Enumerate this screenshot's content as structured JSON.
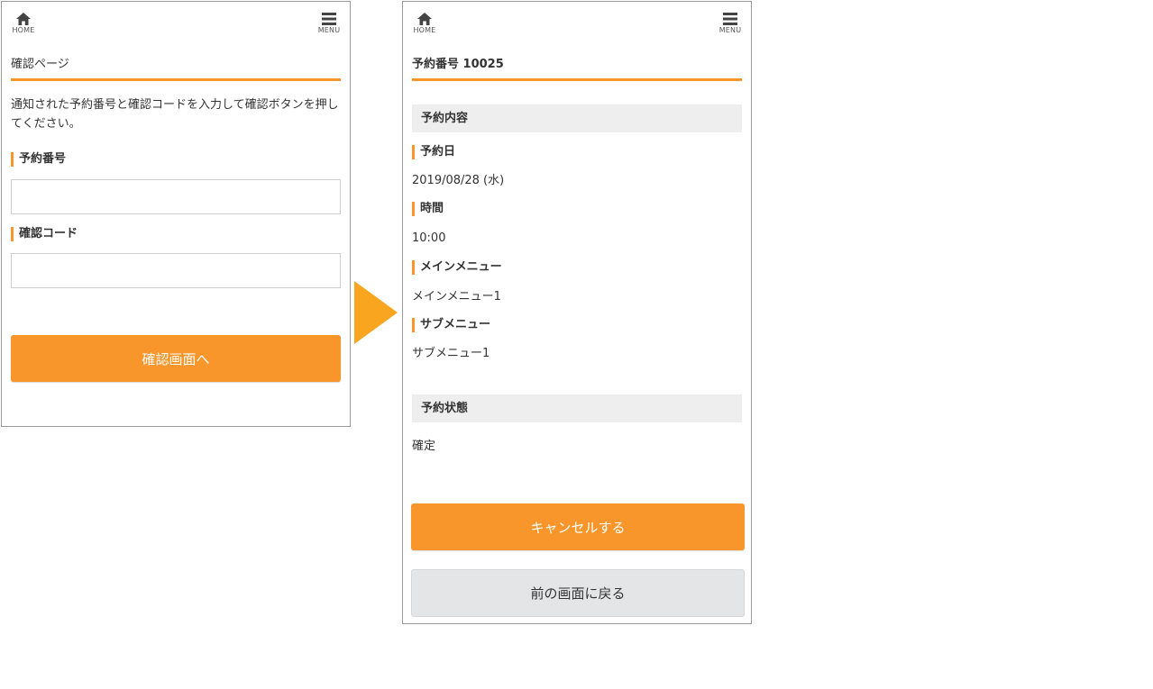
{
  "screen1": {
    "home_label": "HOME",
    "menu_label": "MENU",
    "title": "確認ページ",
    "intro": "通知された予約番号と確認コードを入力して確認ボタンを押してください。",
    "reservation_number_label": "予約番号",
    "reservation_number_value": "",
    "confirmation_code_label": "確認コード",
    "confirmation_code_value": "",
    "submit_label": "確認画面へ"
  },
  "screen2": {
    "home_label": "HOME",
    "menu_label": "MENU",
    "title": "予約番号 10025",
    "details_header": "予約内容",
    "date_label": "予約日",
    "date_value": "2019/08/28 (水)",
    "time_label": "時間",
    "time_value": "10:00",
    "main_menu_label": "メインメニュー",
    "main_menu_value": "メインメニュー1",
    "sub_menu_label": "サブメニュー",
    "sub_menu_value": "サブメニュー1",
    "status_header": "予約状態",
    "status_value": "確定",
    "cancel_label": "キャンセルする",
    "back_label": "前の画面に戻る"
  },
  "colors": {
    "accent": "#f8962b",
    "arrow": "#f9a520",
    "section_bg": "#eeeeee",
    "secondary_button_bg": "#e4e5e7"
  },
  "icons": [
    "home-icon",
    "hamburger-menu-icon",
    "right-arrow-icon"
  ]
}
